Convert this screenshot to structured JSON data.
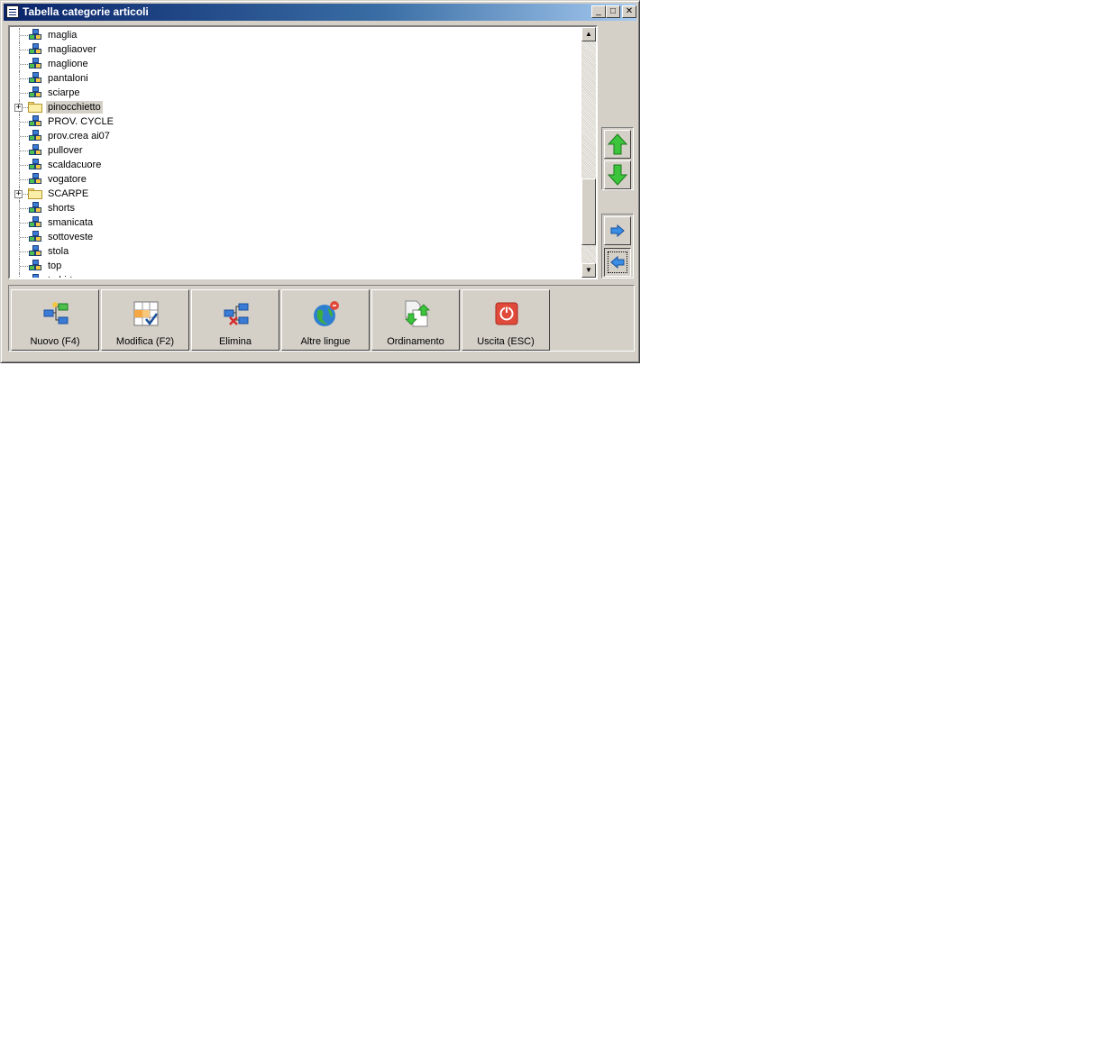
{
  "window": {
    "title": "Tabella categorie articoli",
    "controls": {
      "minimize": "_",
      "maximize": "□",
      "close": "✕"
    }
  },
  "tree": {
    "items": [
      {
        "label": "maglia",
        "icon": "category-cubes-icon",
        "expandable": false,
        "selected": false
      },
      {
        "label": "magliaover",
        "icon": "category-cubes-icon",
        "expandable": false,
        "selected": false
      },
      {
        "label": "maglione",
        "icon": "category-cubes-icon",
        "expandable": false,
        "selected": false
      },
      {
        "label": "pantaloni",
        "icon": "category-cubes-icon",
        "expandable": false,
        "selected": false
      },
      {
        "label": "sciarpe",
        "icon": "category-cubes-icon",
        "expandable": false,
        "selected": false
      },
      {
        "label": "pinocchietto",
        "icon": "folder-icon",
        "expandable": true,
        "selected": true
      },
      {
        "label": "PROV. CYCLE",
        "icon": "category-cubes-icon",
        "expandable": false,
        "selected": false
      },
      {
        "label": "prov.crea ai07",
        "icon": "category-cubes-icon",
        "expandable": false,
        "selected": false
      },
      {
        "label": "pullover",
        "icon": "category-cubes-icon",
        "expandable": false,
        "selected": false
      },
      {
        "label": "scaldacuore",
        "icon": "category-cubes-icon",
        "expandable": false,
        "selected": false
      },
      {
        "label": "vogatore",
        "icon": "category-cubes-icon",
        "expandable": false,
        "selected": false
      },
      {
        "label": "SCARPE",
        "icon": "folder-icon",
        "expandable": true,
        "selected": false
      },
      {
        "label": "shorts",
        "icon": "category-cubes-icon",
        "expandable": false,
        "selected": false
      },
      {
        "label": "smanicata",
        "icon": "category-cubes-icon",
        "expandable": false,
        "selected": false
      },
      {
        "label": "sottoveste",
        "icon": "category-cubes-icon",
        "expandable": false,
        "selected": false
      },
      {
        "label": "stola",
        "icon": "category-cubes-icon",
        "expandable": false,
        "selected": false
      },
      {
        "label": "top",
        "icon": "category-cubes-icon",
        "expandable": false,
        "selected": false
      },
      {
        "label": "t-shirt",
        "icon": "category-cubes-icon",
        "expandable": false,
        "selected": false
      }
    ],
    "expand_glyph": "+",
    "scroll": {
      "up_glyph": "▲",
      "down_glyph": "▼"
    }
  },
  "side_buttons": {
    "move_up": "arrow-up-green-icon",
    "move_down": "arrow-down-green-icon",
    "indent": "arrow-right-blue-icon",
    "outdent": "arrow-left-blue-icon"
  },
  "toolbar": {
    "buttons": [
      {
        "label": "Nuovo (F4)",
        "icon": "new-node-icon"
      },
      {
        "label": "Modifica (F2)",
        "icon": "edit-grid-icon"
      },
      {
        "label": "Elimina",
        "icon": "delete-node-icon"
      },
      {
        "label": "Altre lingue",
        "icon": "globe-icon"
      },
      {
        "label": "Ordinamento",
        "icon": "sort-documents-icon"
      },
      {
        "label": "Uscita (ESC)",
        "icon": "exit-power-icon"
      }
    ]
  },
  "colors": {
    "titlebar_start": "#0a246a",
    "titlebar_end": "#a6caf0",
    "face": "#d4d0c8",
    "arrow_green": "#3cc43c",
    "arrow_blue": "#3a8ee6",
    "exit_red": "#e04a3a"
  }
}
